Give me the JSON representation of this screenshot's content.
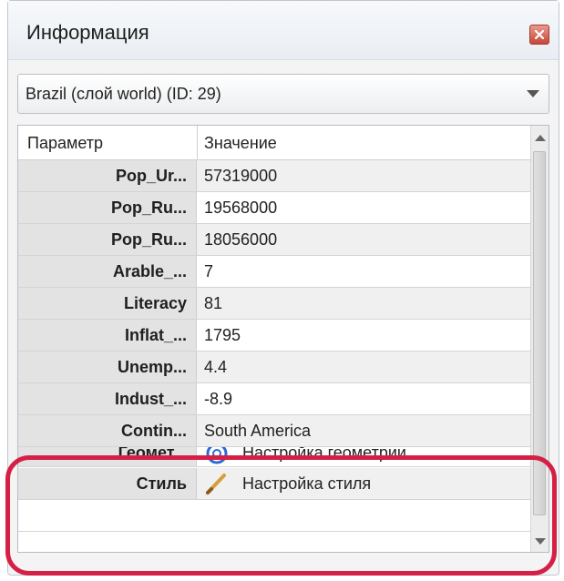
{
  "window": {
    "title": "Информация",
    "close_icon": "close-icon"
  },
  "dropdown": {
    "selected": "Brazil (слой world) (ID: 29)",
    "arrow_icon": "chevron-down-icon"
  },
  "grid": {
    "headers": [
      "Параметр",
      "Значение"
    ],
    "rows": [
      {
        "param": "Pop_Ur...",
        "value": "57319000"
      },
      {
        "param": "Pop_Ru...",
        "value": "19568000"
      },
      {
        "param": "Pop_Ru...",
        "value": "18056000"
      },
      {
        "param": "Arable_...",
        "value": "7"
      },
      {
        "param": "Literacy",
        "value": "81"
      },
      {
        "param": "Inflat_...",
        "value": "1795"
      },
      {
        "param": "Unemp...",
        "value": "4.4"
      },
      {
        "param": "Indust_...",
        "value": "-8.9"
      },
      {
        "param": "Contin...",
        "value": "South America"
      },
      {
        "param": "Геомет...",
        "value": "Настройка геометрии",
        "icon": "geometry-settings-icon"
      },
      {
        "param": "Стиль",
        "value": "Настройка стиля",
        "icon": "brush-icon"
      }
    ]
  },
  "colors": {
    "highlight": "#d61f45",
    "param_bg": "#e3e3e3"
  }
}
